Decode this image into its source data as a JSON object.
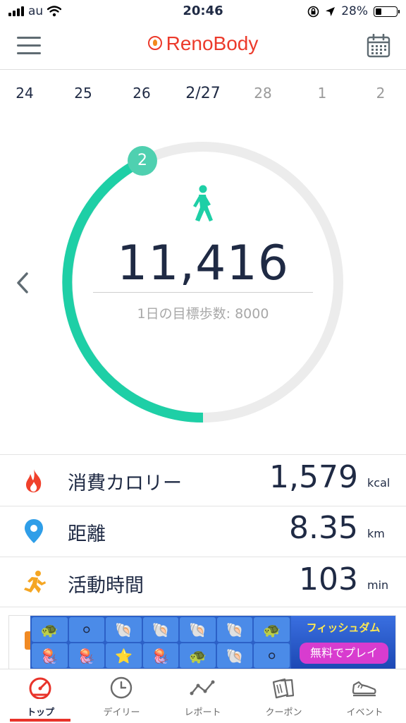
{
  "status_bar": {
    "carrier": "au",
    "time": "20:46",
    "battery": "28%"
  },
  "app": {
    "title": "RenoBody"
  },
  "dates": [
    {
      "label": "24",
      "state": "past"
    },
    {
      "label": "25",
      "state": "past"
    },
    {
      "label": "26",
      "state": "past"
    },
    {
      "label": "2/27",
      "state": "active"
    },
    {
      "label": "28",
      "state": "future"
    },
    {
      "label": "1",
      "state": "future"
    },
    {
      "label": "2",
      "state": "future"
    }
  ],
  "steps": {
    "badge": "2",
    "count": "11,416",
    "goal_text": "1日の目標歩数: 8000",
    "ring_color": "#1ecfa6",
    "track_color": "#ececec"
  },
  "stats": [
    {
      "icon": "flame-icon",
      "label": "消費カロリー",
      "value": "1,579",
      "unit": "kcal",
      "color": "#f0402b"
    },
    {
      "icon": "location-pin-icon",
      "label": "距離",
      "value": "8.35",
      "unit": "km",
      "color": "#2f9ee8"
    },
    {
      "icon": "running-icon",
      "label": "活動時間",
      "value": "103",
      "unit": "min",
      "color": "#f5a623"
    }
  ],
  "ad": {
    "title": "フィッシュダム",
    "cta": "無料でプレイ",
    "tiles": [
      "🐢",
      "⚪",
      "🐚",
      "🐚",
      "🐚",
      "🐚",
      "🐢",
      "🪼",
      "🪼",
      "⭐",
      "🪼",
      "🐢",
      "🐚",
      "⚪"
    ]
  },
  "tabs": [
    {
      "label": "トップ",
      "icon": "gauge-icon",
      "active": true
    },
    {
      "label": "デイリー",
      "icon": "clock-icon",
      "active": false
    },
    {
      "label": "レポート",
      "icon": "line-chart-icon",
      "active": false
    },
    {
      "label": "クーポン",
      "icon": "coupon-icon",
      "active": false
    },
    {
      "label": "イベント",
      "icon": "sneaker-icon",
      "active": false
    }
  ],
  "colors": {
    "accent": "#e8332a",
    "brand": "#ec3a2b"
  }
}
